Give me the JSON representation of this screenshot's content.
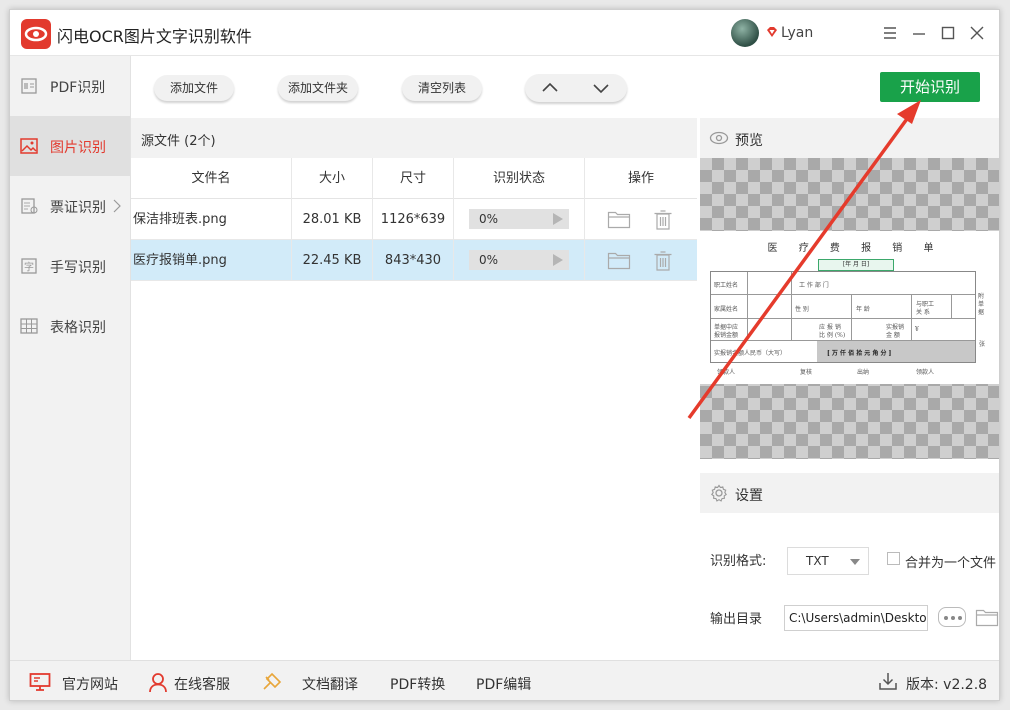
{
  "app": {
    "title": "闪电OCR图片文字识别软件",
    "username": "Lyan"
  },
  "sidebar": {
    "items": [
      {
        "label": "PDF识别",
        "icon": "pdf-icon"
      },
      {
        "label": "图片识别",
        "icon": "image-icon",
        "active": true
      },
      {
        "label": "票证识别",
        "icon": "ticket-icon"
      },
      {
        "label": "手写识别",
        "icon": "handwriting-icon"
      },
      {
        "label": "表格识别",
        "icon": "table-icon"
      }
    ]
  },
  "toolbar": {
    "add_file": "添加文件",
    "add_folder": "添加文件夹",
    "clear_list": "清空列表",
    "start": "开始识别"
  },
  "files": {
    "header": "源文件 (2个)",
    "columns": [
      "文件名",
      "大小",
      "尺寸",
      "识别状态",
      "操作"
    ],
    "rows": [
      {
        "name": "保洁排班表.png",
        "size": "28.01 KB",
        "dims": "1126*639",
        "progress": "0%"
      },
      {
        "name": "医疗报销单.png",
        "size": "22.45 KB",
        "dims": "843*430",
        "progress": "0%"
      }
    ]
  },
  "preview": {
    "title": "预览",
    "doc": {
      "heading": "医 疗 费 报 销 单",
      "date": "[年 月 日]",
      "fields": [
        "职工姓名",
        "工 作 部 门",
        "家属姓名",
        "性 别",
        "年 龄",
        "与职工",
        "关 系",
        "单据中应",
        "报销金额",
        "应 报 销",
        "比 例 (%)",
        "实报销",
        "金 额",
        "¥",
        "实报销金额人民币（大写）",
        "[ 万 仟 佰 拾 元 角 分 ]",
        "领款人",
        "复核",
        "出纳",
        "领款人",
        "附单据",
        "张"
      ]
    }
  },
  "settings": {
    "title": "设置",
    "format_label": "识别格式:",
    "format_value": "TXT",
    "merge_label": "合并为一个文件",
    "output_label": "输出目录",
    "output_path": "C:\\Users\\admin\\Desktop"
  },
  "footer": {
    "website": "官方网站",
    "service": "在线客服",
    "translate": "文档翻译",
    "pdf_convert": "PDF转换",
    "pdf_edit": "PDF编辑",
    "version": "版本: v2.2.8"
  },
  "colors": {
    "accent": "#e23a2e",
    "start_button": "#19a24a",
    "selected_row": "#d2ebf9"
  }
}
